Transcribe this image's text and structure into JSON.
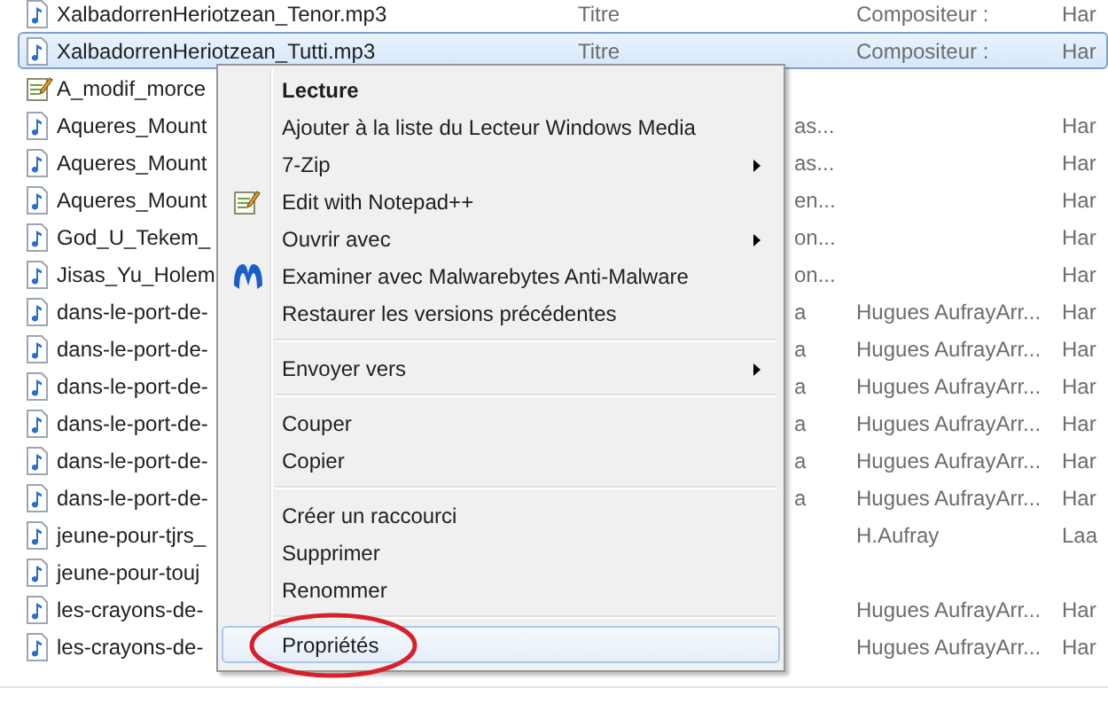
{
  "files": [
    {
      "kind": "audio",
      "selected": false,
      "name": "XalbadorrenHeriotzean_Tenor.mp3",
      "column_2": "Titre",
      "column_3": "Compositeur :",
      "column_4": "Har"
    },
    {
      "kind": "audio",
      "selected": true,
      "name": "XalbadorrenHeriotzean_Tutti.mp3",
      "column_2": "Titre",
      "column_3": "Compositeur :",
      "column_4": "Har"
    },
    {
      "kind": "text",
      "selected": false,
      "name": "A_modif_morce"
    },
    {
      "kind": "audio",
      "selected": false,
      "name": "Aqueres_Mount",
      "column_2": "as...",
      "column_4": "Har"
    },
    {
      "kind": "audio",
      "selected": false,
      "name": "Aqueres_Mount",
      "column_2": "as...",
      "column_4": "Har"
    },
    {
      "kind": "audio",
      "selected": false,
      "name": "Aqueres_Mount",
      "column_2": "en...",
      "column_4": "Har"
    },
    {
      "kind": "audio",
      "selected": false,
      "name": "God_U_Tekem_",
      "column_2": "on...",
      "column_4": "Har"
    },
    {
      "kind": "audio",
      "selected": false,
      "name": "Jisas_Yu_Holem",
      "column_2": "on...",
      "column_4": "Har"
    },
    {
      "kind": "audio",
      "selected": false,
      "name": "dans-le-port-de-",
      "column_2": "a",
      "column_3": "Hugues AufrayArr...",
      "column_4": "Har"
    },
    {
      "kind": "audio",
      "selected": false,
      "name": "dans-le-port-de-",
      "column_2": "a",
      "column_3": "Hugues AufrayArr...",
      "column_4": "Har"
    },
    {
      "kind": "audio",
      "selected": false,
      "name": "dans-le-port-de-",
      "column_2": "a",
      "column_3": "Hugues AufrayArr...",
      "column_4": "Har"
    },
    {
      "kind": "audio",
      "selected": false,
      "name": "dans-le-port-de-",
      "column_2": "a",
      "column_3": "Hugues AufrayArr...",
      "column_4": "Har"
    },
    {
      "kind": "audio",
      "selected": false,
      "name": "dans-le-port-de-",
      "column_2": "a",
      "column_3": "Hugues AufrayArr...",
      "column_4": "Har"
    },
    {
      "kind": "audio",
      "selected": false,
      "name": "dans-le-port-de-",
      "column_2": "a",
      "column_3": "Hugues AufrayArr...",
      "column_4": "Har"
    },
    {
      "kind": "audio",
      "selected": false,
      "name": "jeune-pour-tjrs_",
      "column_3": "H.Aufray",
      "column_4": "Laa"
    },
    {
      "kind": "audio",
      "selected": false,
      "name": "jeune-pour-touj"
    },
    {
      "kind": "audio",
      "selected": false,
      "name": "les-crayons-de-",
      "column_3": "Hugues AufrayArr...",
      "column_4": "Har"
    },
    {
      "kind": "audio",
      "selected": false,
      "name": "les-crayons-de-",
      "column_3": "Hugues AufrayArr...",
      "column_4": "Har"
    }
  ],
  "context_menu": [
    {
      "kind": "plain",
      "label": "Lecture",
      "bold": true,
      "submenu": false,
      "selected": false
    },
    {
      "kind": "plain",
      "label": "Ajouter à la liste du Lecteur Windows Media",
      "submenu": false,
      "selected": false
    },
    {
      "kind": "plain",
      "label": "7-Zip",
      "submenu": true,
      "selected": false
    },
    {
      "kind": "notepad",
      "label": "Edit with Notepad++",
      "submenu": false,
      "selected": false
    },
    {
      "kind": "plain",
      "label": "Ouvrir avec",
      "submenu": true,
      "selected": false
    },
    {
      "kind": "scanner",
      "label": "Examiner avec Malwarebytes Anti-Malware",
      "submenu": false,
      "selected": false
    },
    {
      "kind": "plain",
      "label": "Restaurer les versions précédentes",
      "submenu": false,
      "selected": false
    },
    {
      "kind": "separator"
    },
    {
      "kind": "plain",
      "label": "Envoyer vers",
      "submenu": true,
      "selected": false
    },
    {
      "kind": "separator"
    },
    {
      "kind": "plain",
      "label": "Couper",
      "submenu": false,
      "selected": false
    },
    {
      "kind": "plain",
      "label": "Copier",
      "submenu": false,
      "selected": false
    },
    {
      "kind": "separator"
    },
    {
      "kind": "plain",
      "label": "Créer un raccourci",
      "submenu": false,
      "selected": false
    },
    {
      "kind": "plain",
      "label": "Supprimer",
      "submenu": false,
      "selected": false
    },
    {
      "kind": "plain",
      "label": "Renommer",
      "submenu": false,
      "selected": false
    },
    {
      "kind": "separator"
    },
    {
      "kind": "plain",
      "label": "Propriétés",
      "submenu": false,
      "selected": true,
      "circled": true
    }
  ]
}
